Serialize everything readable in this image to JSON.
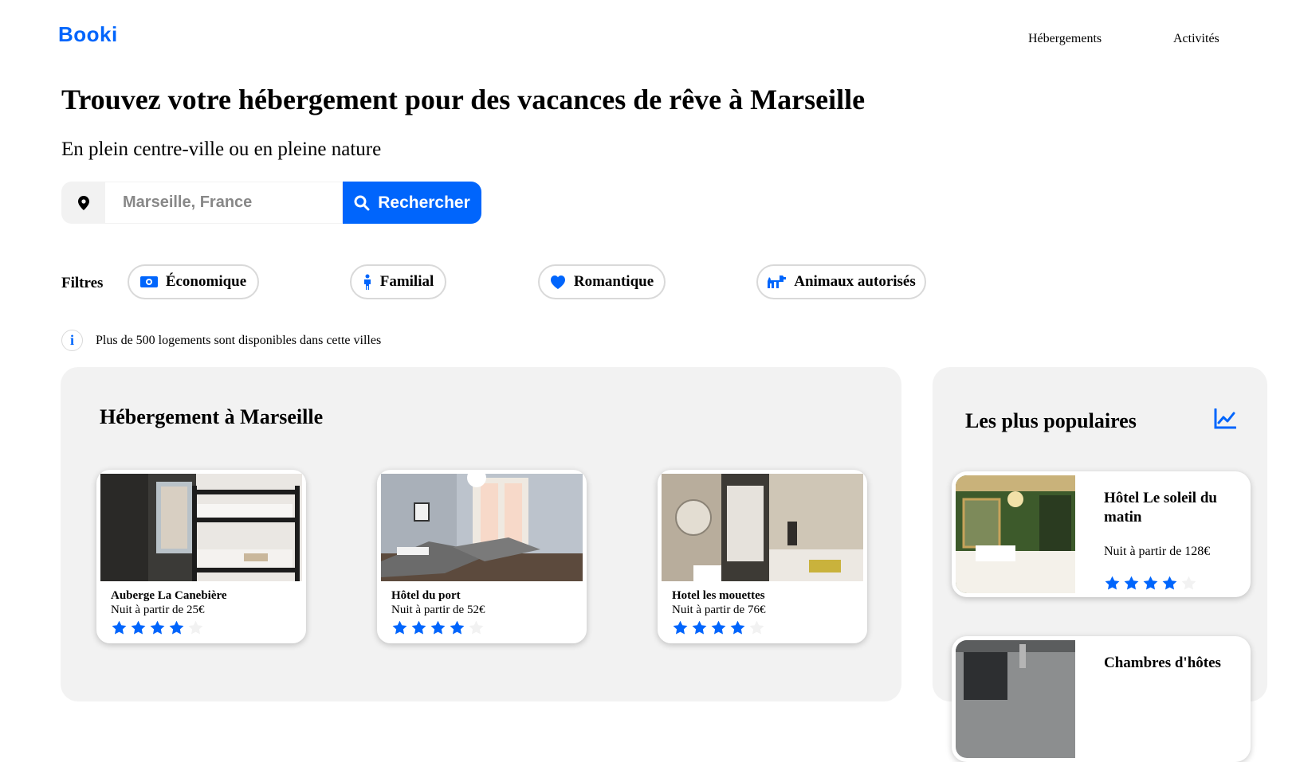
{
  "header": {
    "logo": "Booki",
    "nav": [
      "Hébergements",
      "Activités"
    ]
  },
  "hero": {
    "title": "Trouvez votre hébergement pour des vacances de rêve à Marseille",
    "subtitle": "En plein centre-ville ou en pleine nature"
  },
  "search": {
    "placeholder": "Marseille, France",
    "button_label": "Rechercher"
  },
  "filters": {
    "label": "Filtres",
    "chips": [
      {
        "label": "Économique",
        "icon": "money-icon"
      },
      {
        "label": "Familial",
        "icon": "child-icon"
      },
      {
        "label": "Romantique",
        "icon": "heart-icon"
      },
      {
        "label": "Animaux autorisés",
        "icon": "dog-icon"
      }
    ]
  },
  "info": {
    "text": "Plus de 500 logements sont disponibles dans cette villes"
  },
  "accommodations": {
    "title": "Hébergement à Marseille",
    "items": [
      {
        "name": "Auberge La Canebière",
        "price": "Nuit à partir de 25€",
        "rating": 4
      },
      {
        "name": "Hôtel du port",
        "price": "Nuit à partir de 52€",
        "rating": 4
      },
      {
        "name": "Hotel les mouettes",
        "price": "Nuit à partir de 76€",
        "rating": 4
      }
    ]
  },
  "popular": {
    "title": "Les plus populaires",
    "items": [
      {
        "name": "Hôtel Le soleil du matin",
        "price": "Nuit à partir de 128€",
        "rating": 4
      },
      {
        "name": "Chambres d'hôtes",
        "price": "",
        "rating": 0
      }
    ]
  },
  "colors": {
    "accent": "#0065FC",
    "panel_bg": "#F2F2F2",
    "star_empty": "#F2F2F2"
  }
}
